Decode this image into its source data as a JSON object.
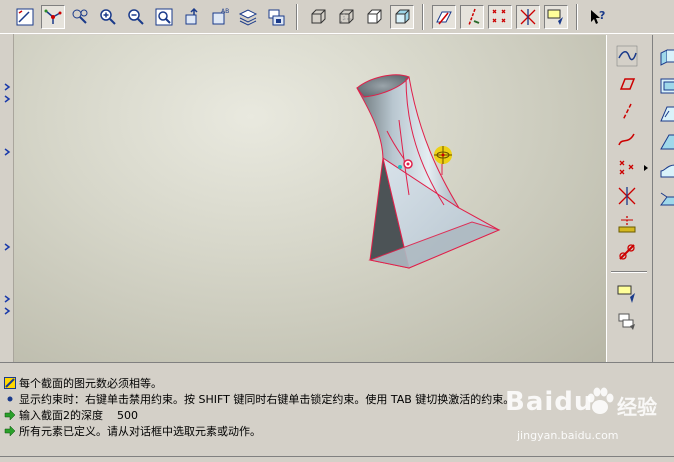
{
  "toolbar": {
    "icons": [
      "redraw-icon",
      "spin-center-icon",
      "orient-icon",
      "zoom-in-icon",
      "zoom-out-icon",
      "refit-icon",
      "reorient-icon",
      "view-manager-icon",
      "layers-icon",
      "model-tree-icon",
      "wireframe-icon",
      "hidden-line-icon",
      "no-hidden-icon",
      "shading-icon",
      "datum-planes-icon",
      "datum-axes-icon",
      "datum-points-icon",
      "coordinate-systems-icon",
      "annotations-icon",
      "context-help-icon"
    ]
  },
  "right_toolbar": {
    "icons": [
      "spline-icon",
      "rectangle-icon",
      "centerline-icon",
      "arc-icon",
      "point-icon",
      "trim-icon",
      "dimension-icon",
      "modify-icon",
      "constraint-icon",
      "palette-icon"
    ]
  },
  "messages": [
    {
      "icon": "info-icon",
      "text": "每个截面的图元数必须相等。"
    },
    {
      "icon": "bullet-icon",
      "text": "显示约束时：右键单击禁用约束。按 SHIFT 键同时右键单击锁定约束。使用 TAB 键切换激活的约束。"
    },
    {
      "icon": "prompt-arrow-icon",
      "text": "输入截面2的深度    500"
    },
    {
      "icon": "prompt-arrow-icon",
      "text": "所有元素已定义。请从对话框中选取元素或动作。"
    }
  ],
  "watermark": {
    "main": "Baidu",
    "cn": "经验",
    "sub": "jingyan.baidu.com"
  },
  "colors": {
    "ui_gray": "#d4d0c8",
    "edge_red": "#e0204a",
    "model_fill": "#c8d4dc",
    "highlight_yellow": "#f0d000"
  }
}
